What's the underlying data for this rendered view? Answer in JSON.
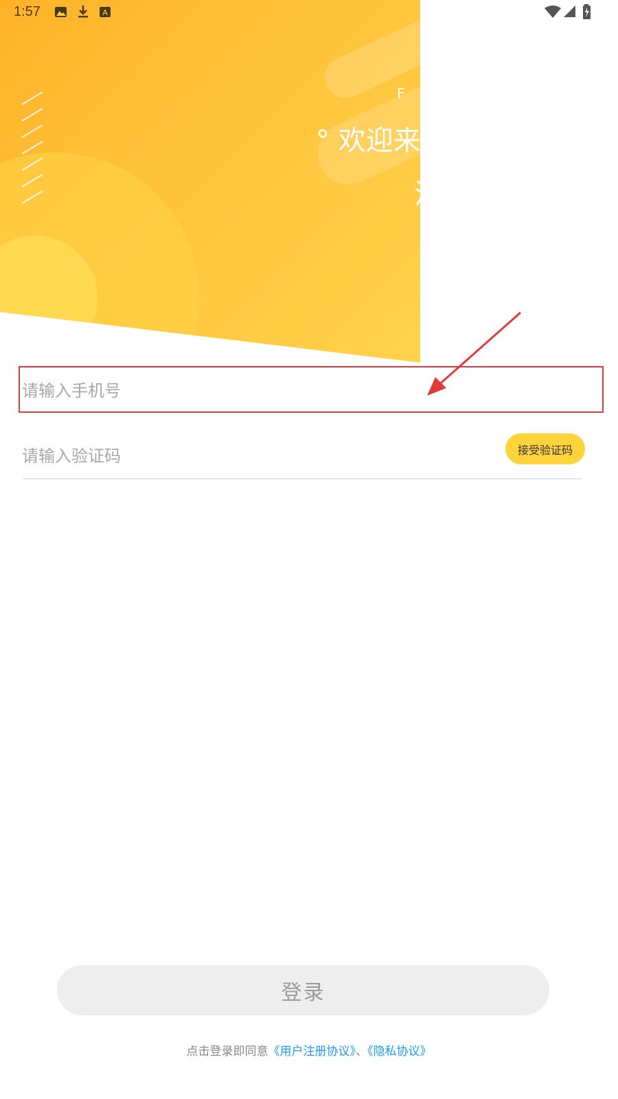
{
  "status_bar": {
    "time": "1:57",
    "icons": [
      "image-icon",
      "download-icon",
      "text-a-icon",
      "wifi-icon",
      "signal-icon",
      "battery-icon"
    ]
  },
  "hero": {
    "subtitle": "F A",
    "title": "° 欢迎来到",
    "title_line2": "注",
    "colors": {
      "start": "#ffb227",
      "end": "#ffd34a"
    }
  },
  "form": {
    "phone_placeholder": "请输入手机号",
    "code_placeholder": "请输入验证码",
    "get_code_label": "接受验证码"
  },
  "login": {
    "label": "登录"
  },
  "agreement": {
    "prefix": "点击登录即同意",
    "terms_link": "《用户注册协议》",
    "separator": "、",
    "privacy_link": "《隐私协议》"
  },
  "colors": {
    "accent": "#ffd43a",
    "link": "#1d9bf0",
    "highlight": "#e03a3a"
  }
}
